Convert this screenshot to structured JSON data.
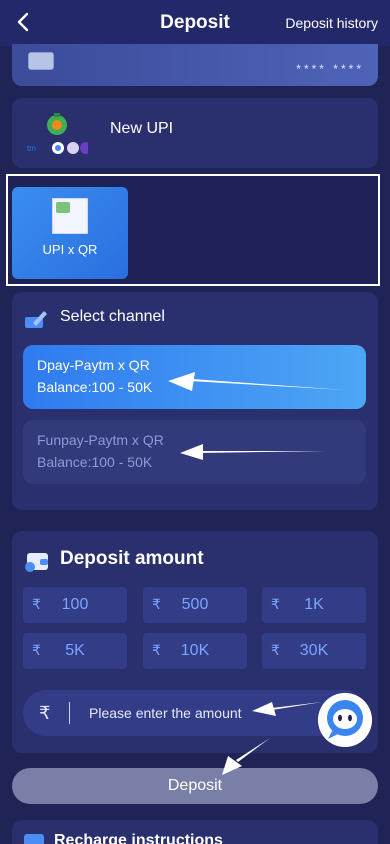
{
  "header": {
    "title": "Deposit",
    "history_link": "Deposit history"
  },
  "card": {
    "mask": "****   ****"
  },
  "upi": {
    "label": "New UPI"
  },
  "payment_method": {
    "label": "UPI x QR"
  },
  "channel": {
    "title": "Select channel",
    "items": [
      {
        "name": "Dpay-Paytm x QR",
        "balance": "Balance:100 - 50K",
        "selected": true
      },
      {
        "name": "Funpay-Paytm x QR",
        "balance": "Balance:100 - 50K",
        "selected": false
      }
    ]
  },
  "amount": {
    "title": "Deposit amount",
    "currency": "₹",
    "quick": [
      "100",
      "500",
      "1K",
      "5K",
      "10K",
      "30K"
    ],
    "input_placeholder": "Please enter the amount"
  },
  "deposit_button": "Deposit",
  "recharge": {
    "title": "Recharge instructions"
  },
  "colors": {
    "accent": "#2f7bef",
    "panel": "#2a2f6e",
    "background": "#1f2356"
  }
}
